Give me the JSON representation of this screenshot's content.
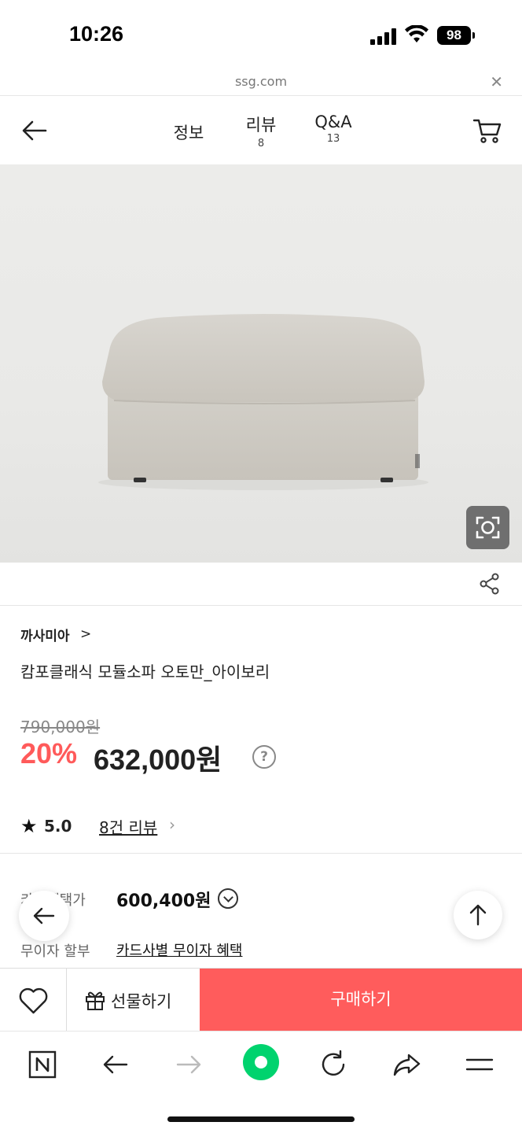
{
  "status_bar": {
    "time": "10:26",
    "battery": "98"
  },
  "url_bar": {
    "domain": "ssg.com"
  },
  "nav": {
    "tabs": [
      {
        "label": "정보",
        "count": ""
      },
      {
        "label": "리뷰",
        "count": "8"
      },
      {
        "label": "Q&A",
        "count": "13"
      }
    ]
  },
  "product": {
    "brand": "까사미아",
    "name": "캄포클래식 모듈소파 오토만_아이보리",
    "original_price": "790,000원",
    "discount": "20%",
    "sale_price": "632,000원",
    "help_symbol": "?",
    "rating": "5.0",
    "review_link": "8건 리뷰",
    "card_label": "카드혜택가",
    "card_price": "600,400원",
    "installment_label": "무이자 할부",
    "installment_link": "카드사별 무이자 혜택"
  },
  "actions": {
    "gift_label": "선물하기",
    "buy_label": "구매하기"
  },
  "colors": {
    "accent": "#ff5c5c",
    "discount": "#ff5a5a",
    "browser_green": "#00d36e"
  }
}
